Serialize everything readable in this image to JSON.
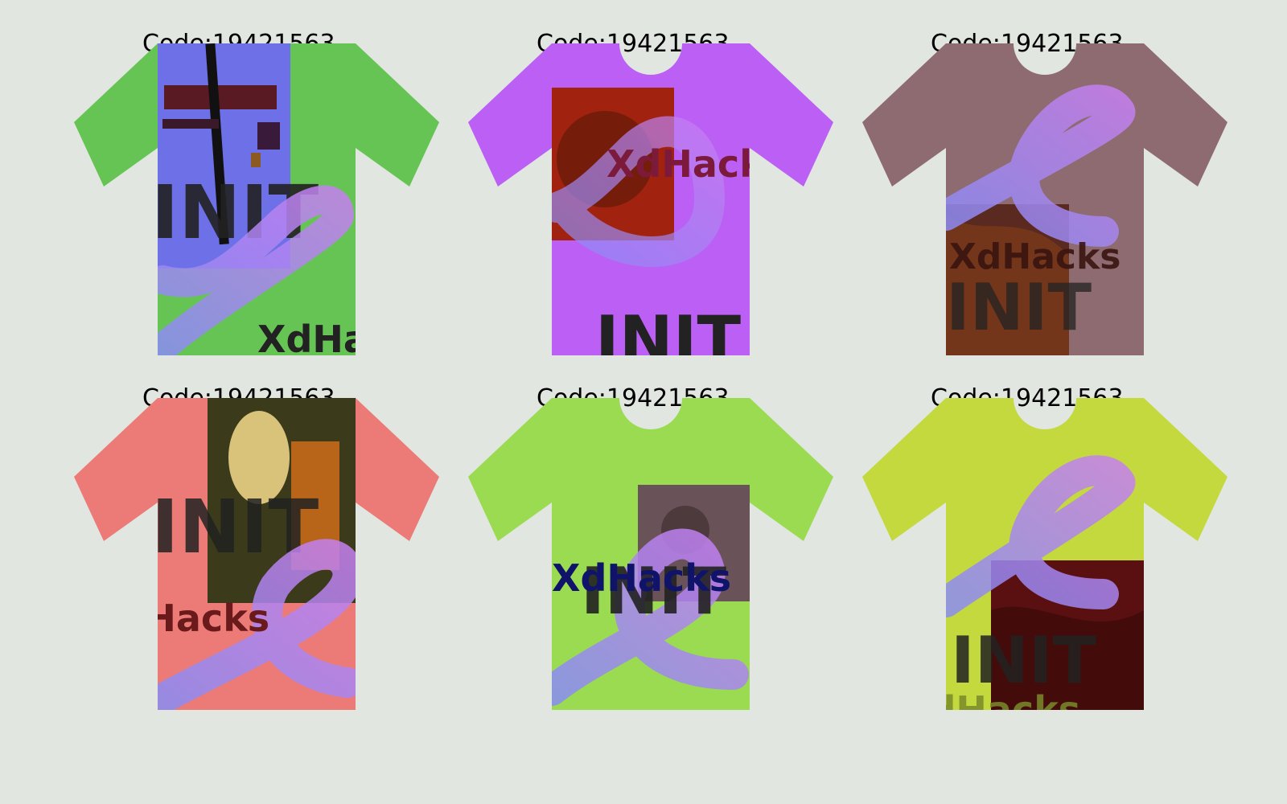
{
  "cards": [
    {
      "code_label": "Code:19421563",
      "shirt_color": "#66c455",
      "art": "suprematist-composition",
      "texts": [
        "INIT",
        "XdHacks"
      ]
    },
    {
      "code_label": "Code:19421563",
      "shirt_color": "#bb5ff5",
      "art": "renaissance-portrait",
      "texts": [
        "XdHacks",
        "INIT"
      ]
    },
    {
      "code_label": "Code:19421563",
      "shirt_color": "#8d6b70",
      "art": "the-scream",
      "texts": [
        "XdHacks",
        "INIT"
      ]
    },
    {
      "code_label": "Code:19421563",
      "shirt_color": "#ec7b77",
      "art": "classical-bust-painting",
      "texts": [
        "INIT",
        "XdHacks"
      ]
    },
    {
      "code_label": "Code:19421563",
      "shirt_color": "#9adb52",
      "art": "abstract-texture",
      "texts": [
        "INIT",
        "XdHacks"
      ]
    },
    {
      "code_label": "Code:19421563",
      "shirt_color": "#c4d93e",
      "art": "red-expressionist-painting",
      "texts": [
        "INIT",
        "XdHacks"
      ]
    }
  ],
  "loop_color_start": "#8a8cf4",
  "loop_color_end": "#c480f0"
}
